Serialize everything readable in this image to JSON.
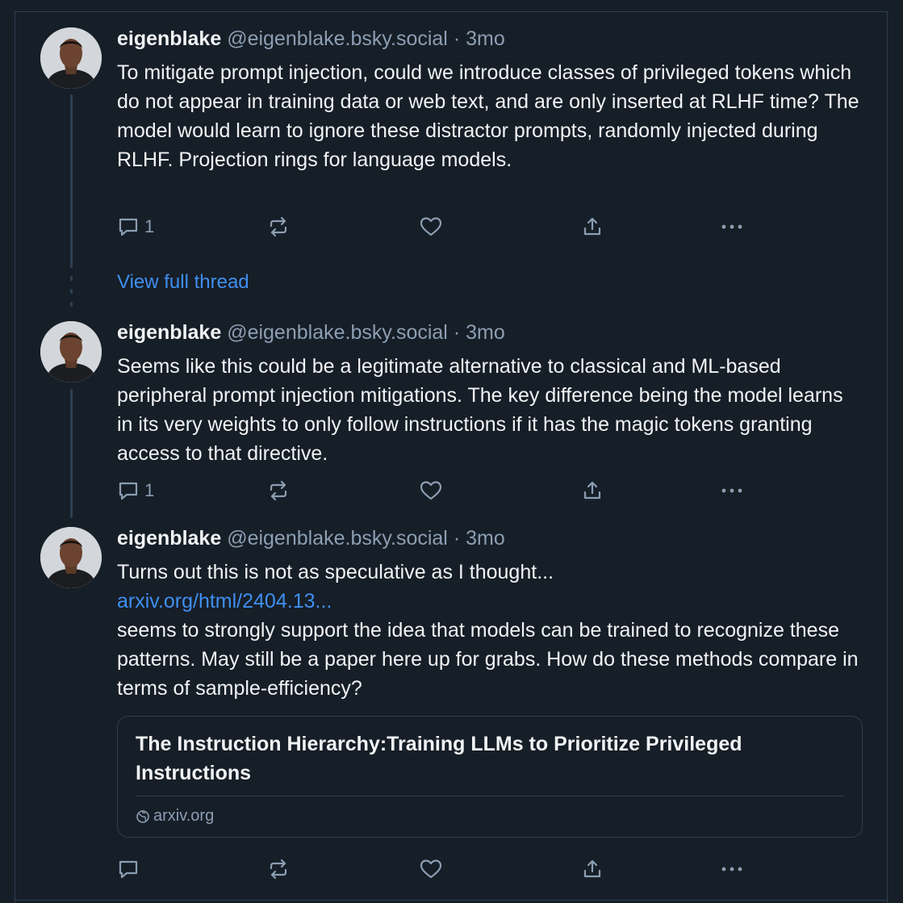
{
  "posts": [
    {
      "author": "eigenblake",
      "handle": "@eigenblake.bsky.social",
      "separator": "·",
      "time": "3mo",
      "text": "To mitigate prompt injection, could we introduce classes of privileged tokens which do not appear in training data or web text, and are only inserted at RLHF time? The model would learn to ignore these distractor prompts, randomly injected during RLHF. Projection rings for language models.",
      "reply_count": "1"
    },
    {
      "author": "eigenblake",
      "handle": "@eigenblake.bsky.social",
      "separator": "·",
      "time": "3mo",
      "text": "Seems like this could be a legitimate alternative to classical and ML-based peripheral prompt injection mitigations. The key difference being the model learns in its very weights to only follow instructions if it has the magic tokens granting access to that directive.",
      "reply_count": "1"
    },
    {
      "author": "eigenblake",
      "handle": "@eigenblake.bsky.social",
      "separator": "·",
      "time": "3mo",
      "text_before": "Turns out this is not as speculative as I thought...",
      "link": "arxiv.org/html/2404.13...",
      "text_after": "seems to strongly support the idea that models can be trained to recognize these patterns. May still be a paper here up for grabs. How do these methods compare in terms of sample-efficiency?",
      "card": {
        "title": "The Instruction Hierarchy:Training LLMs to Prioritize Privileged Instructions",
        "domain": "arxiv.org"
      },
      "reply_count": ""
    }
  ],
  "view_full_thread": "View full thread",
  "icons": [
    "reply-icon",
    "repost-icon",
    "like-icon",
    "share-icon",
    "more-icon",
    "globe-icon"
  ],
  "colors": {
    "background": "#161e27",
    "link": "#3f8ff0",
    "muted": "#8c9eb2",
    "border": "#2e4052",
    "text": "#f1f3f5"
  }
}
